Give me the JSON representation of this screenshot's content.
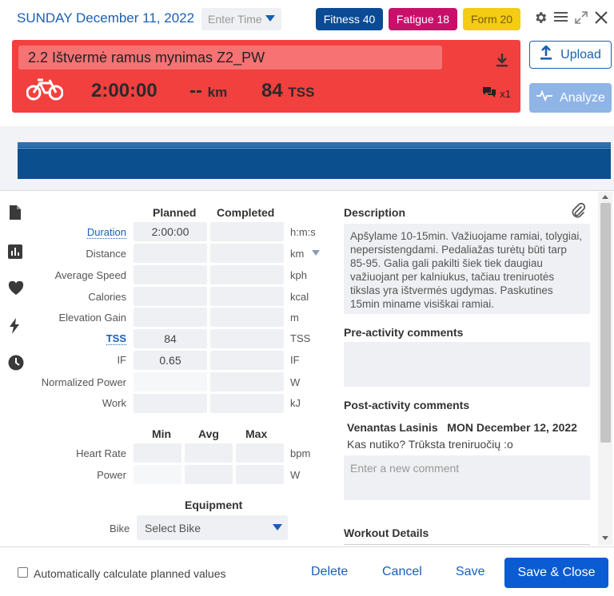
{
  "header": {
    "date": "SUNDAY December 11, 2022",
    "time_placeholder": "Enter Time",
    "fitness": "Fitness 40",
    "fatigue": "Fatigue 18",
    "form": "Form 20",
    "colors": {
      "fitness": "#0b4a94",
      "fatigue": "#c8106b",
      "form": "#f3cc13"
    }
  },
  "workout": {
    "title": "2.2 Ištvermė ramus mynimas Z2_PW",
    "duration": "2:00:00",
    "distance": "--",
    "distance_unit": "km",
    "tss": "84",
    "tss_unit": "TSS",
    "comment_count": "x1",
    "bar_color": "#f2403f"
  },
  "actions": {
    "upload": "Upload",
    "analyze": "Analyze"
  },
  "form": {
    "col_planned": "Planned",
    "col_completed": "Completed",
    "rows": [
      {
        "label": "Duration",
        "planned": "2:00:00",
        "completed": "",
        "unit": "h:m:s"
      },
      {
        "label": "Distance",
        "planned": "",
        "completed": "",
        "unit": "km"
      },
      {
        "label": "Average Speed",
        "planned": "",
        "completed": "",
        "unit": "kph"
      },
      {
        "label": "Calories",
        "planned": "",
        "completed": "",
        "unit": "kcal"
      },
      {
        "label": "Elevation Gain",
        "planned": "",
        "completed": "",
        "unit": "m"
      },
      {
        "label": "TSS",
        "planned": "84",
        "completed": "",
        "unit": "TSS"
      },
      {
        "label": "IF",
        "planned": "0.65",
        "completed": "",
        "unit": "IF"
      },
      {
        "label": "Normalized Power",
        "planned": "",
        "completed": "",
        "unit": "W"
      },
      {
        "label": "Work",
        "planned": "",
        "completed": "",
        "unit": "kJ"
      }
    ],
    "col_min": "Min",
    "col_avg": "Avg",
    "col_max": "Max",
    "range_rows": [
      {
        "label": "Heart Rate",
        "unit": "bpm"
      },
      {
        "label": "Power",
        "unit": "W"
      }
    ],
    "equipment_heading": "Equipment",
    "bike_label": "Bike",
    "bike_value": "Select Bike"
  },
  "right": {
    "description_heading": "Description",
    "description": "Apšylame 10-15min. Važiuojame ramiai, tolygiai, nepersistengdami. Pedaliažas turėtų būti tarp 85-95. Galia gali pakilti šiek tiek daugiau važiuojant per kalniukus, tačiau treniruotės tikslas yra ištvermės ugdymas. Paskutines 15min miname visiškai ramiai.",
    "pre_heading": "Pre-activity comments",
    "post_heading": "Post-activity comments",
    "comment_author": "Venantas Lasinis",
    "comment_date": "MON December 12, 2022",
    "comment_text": "Kas nutiko? Trūksta treniruočių :o",
    "comment_placeholder": "Enter a new comment",
    "workout_details_heading": "Workout Details"
  },
  "footer": {
    "auto_calc_label": "Automatically calculate planned values",
    "delete": "Delete",
    "cancel": "Cancel",
    "save": "Save",
    "save_close": "Save & Close"
  }
}
